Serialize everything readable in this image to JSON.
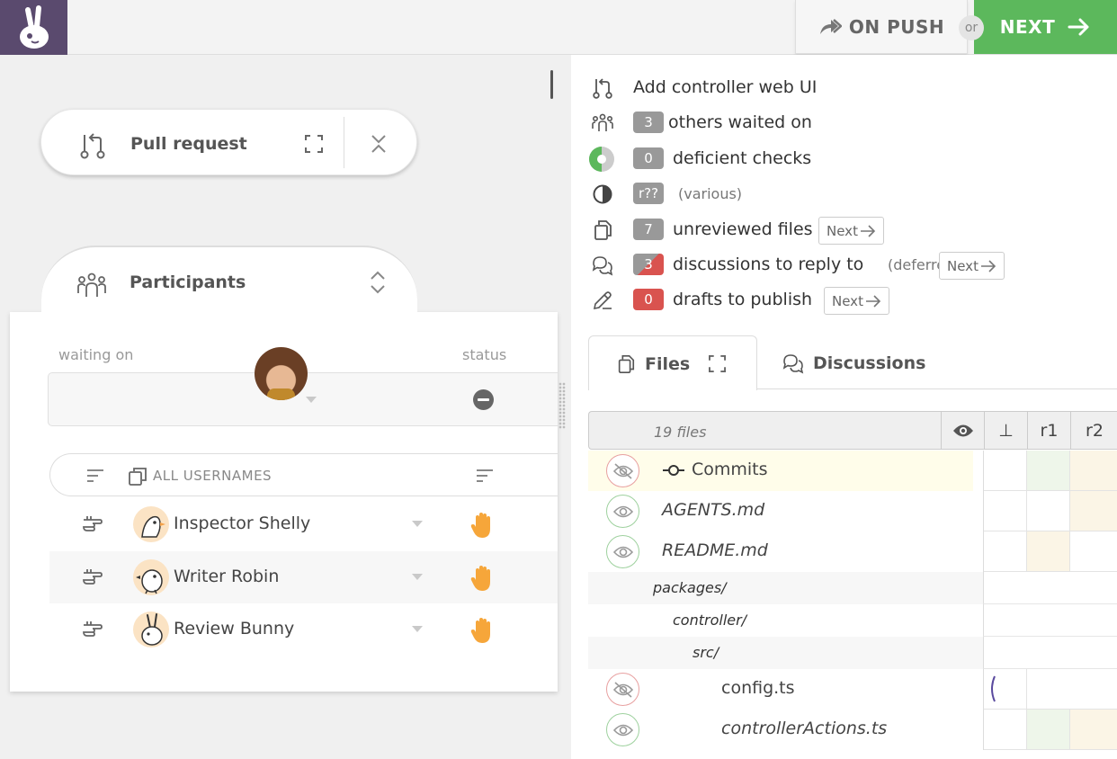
{
  "topbar": {
    "on_push_label": "ON PUSH",
    "or_label": "or",
    "next_label": "NEXT",
    "accent": "#5cb85c",
    "logo_bg": "#5a4a6e"
  },
  "pull_request": {
    "title": "Pull request"
  },
  "participants": {
    "title": "Participants",
    "waiting_on_label": "waiting on",
    "status_label": "status",
    "filter_label": "ALL USERNAMES",
    "users": [
      {
        "name": "Inspector Shelly"
      },
      {
        "name": "Writer Robin"
      },
      {
        "name": "Review Bunny"
      }
    ]
  },
  "summary": {
    "pr_title": "Add controller web UI",
    "others_count": "3",
    "others_label": "others waited on",
    "checks_count": "0",
    "checks_label": "deficient checks",
    "revision_badge": "r??",
    "revision_note": "(various)",
    "unreviewed_count": "7",
    "unreviewed_label": "unreviewed files",
    "discussions_count": "3",
    "discussions_label": "discussions to reply to",
    "discussions_note": "(deferred)",
    "drafts_count": "0",
    "drafts_label": "drafts to publish",
    "next_small": "Next"
  },
  "tabs": {
    "files": "Files",
    "discussions": "Discussions"
  },
  "files_table": {
    "count_label": "19 files",
    "columns": [
      "⊥",
      "r1",
      "r2"
    ],
    "rows": [
      {
        "name": "Commits",
        "kind": "commits"
      },
      {
        "name": "AGENTS.md"
      },
      {
        "name": "README.md"
      },
      {
        "name": "packages/"
      },
      {
        "name": "controller/"
      },
      {
        "name": "src/"
      },
      {
        "name": "config.ts"
      },
      {
        "name": "controllerActions.ts"
      }
    ]
  }
}
